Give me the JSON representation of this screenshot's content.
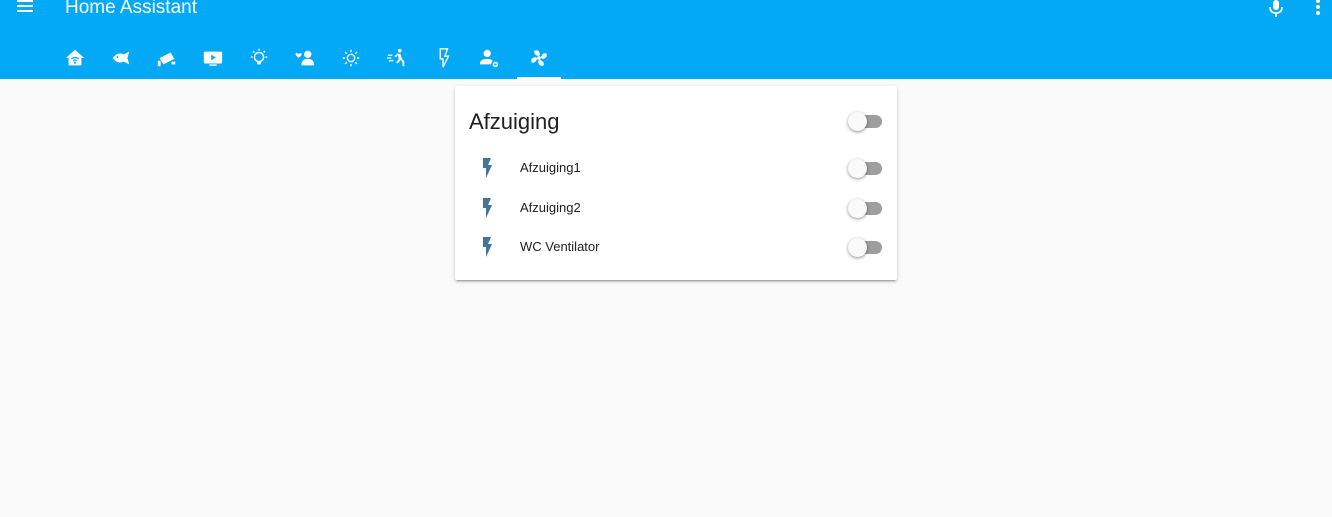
{
  "header": {
    "title": "Home Assistant",
    "menu_icon": "menu-icon",
    "mic_icon": "microphone-icon",
    "more_icon": "more-vert-icon",
    "background": "#03a9f4"
  },
  "tabs": [
    {
      "icon": "home-icon",
      "active": false
    },
    {
      "icon": "fish-icon",
      "active": false
    },
    {
      "icon": "cctv-icon",
      "active": false
    },
    {
      "icon": "youtube-tv-icon",
      "active": false
    },
    {
      "icon": "lightbulb-icon",
      "active": false
    },
    {
      "icon": "account-heart-icon",
      "active": false
    },
    {
      "icon": "brightness-icon",
      "active": false
    },
    {
      "icon": "run-fast-icon",
      "active": false
    },
    {
      "icon": "flash-icon",
      "active": false
    },
    {
      "icon": "account-settings-icon",
      "active": false
    },
    {
      "icon": "fan-icon",
      "active": true
    }
  ],
  "card": {
    "title": "Afzuiging",
    "title_toggle": "off",
    "entities": [
      {
        "name": "Afzuiging1",
        "icon": "flash-icon",
        "state": "off"
      },
      {
        "name": "Afzuiging2",
        "icon": "flash-icon",
        "state": "off"
      },
      {
        "name": "WC Ventilator",
        "icon": "flash-icon",
        "state": "off"
      }
    ],
    "icon_color": "#44739e"
  }
}
